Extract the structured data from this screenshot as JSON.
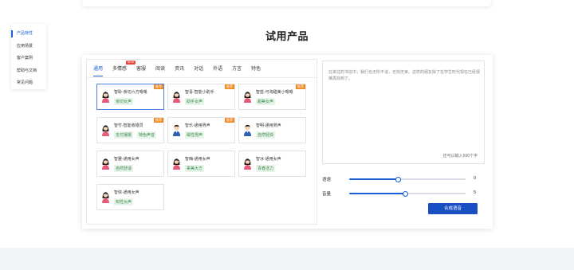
{
  "side_nav": {
    "items": [
      {
        "label": "产品特性",
        "active": true
      },
      {
        "label": "应用场景",
        "active": false
      },
      {
        "label": "客户案例",
        "active": false
      },
      {
        "label": "帮助与文档",
        "active": false
      },
      {
        "label": "常见问题",
        "active": false
      }
    ]
  },
  "section_title": "试用产品",
  "tabs": [
    {
      "label": "通用",
      "active": true,
      "badge": null
    },
    {
      "label": "多情感",
      "active": false,
      "badge": "NEW"
    },
    {
      "label": "客服",
      "active": false,
      "badge": null
    },
    {
      "label": "阅读",
      "active": false,
      "badge": null
    },
    {
      "label": "资讯",
      "active": false,
      "badge": null
    },
    {
      "label": "对话",
      "active": false,
      "badge": null
    },
    {
      "label": "外语",
      "active": false,
      "badge": null
    },
    {
      "label": "方言",
      "active": false,
      "badge": null
    },
    {
      "label": "特色",
      "active": false,
      "badge": null
    }
  ],
  "voices": [
    {
      "name": "智聆-亲切六方嗯嗯",
      "tags": [
        "亲切女声"
      ],
      "badge": "推荐",
      "selected": true,
      "gender": "female"
    },
    {
      "name": "智喜-智能小助手",
      "tags": [
        "助手女声"
      ],
      "badge": "推荐",
      "selected": false,
      "gender": "female"
    },
    {
      "name": "智蓝-可淘甜美小嗯嗯",
      "tags": [
        "甜美女声"
      ],
      "badge": "推荐",
      "selected": false,
      "gender": "female"
    },
    {
      "name": "智竹-智能收银员",
      "tags": [
        "支付播报",
        "特色声音"
      ],
      "badge": "推荐",
      "selected": false,
      "gender": "female"
    },
    {
      "name": "智乐-通用男声",
      "tags": [
        "磁性男声"
      ],
      "badge": "推荐",
      "selected": false,
      "gender": "male"
    },
    {
      "name": "智明-通用男声",
      "tags": [
        "自然轻快"
      ],
      "badge": null,
      "selected": false,
      "gender": "male"
    },
    {
      "name": "智雅-通用女声",
      "tags": [
        "自然舒适"
      ],
      "badge": null,
      "selected": false,
      "gender": "female"
    },
    {
      "name": "智梅-通用女声",
      "tags": [
        "柔美大方"
      ],
      "badge": null,
      "selected": false,
      "gender": "female"
    },
    {
      "name": "智冰-通用女声",
      "tags": [
        "青春活力"
      ],
      "badge": null,
      "selected": false,
      "gender": "female"
    },
    {
      "name": "智依-通用女声",
      "tags": [
        "知性女声"
      ],
      "badge": null,
      "selected": false,
      "gender": "female"
    }
  ],
  "text_input": {
    "value": "在来往的书信中，我们也无所不谈，无拘无束。这样的朋友除了在学生时代现在已经很难再找到了。",
    "char_limit": "还可以输入500个字"
  },
  "sliders": [
    {
      "label": "语速",
      "value": "0",
      "level": 0.42
    },
    {
      "label": "音量",
      "value": "5",
      "level": 0.48
    }
  ],
  "synth_button": "合成语音",
  "colors": {
    "accent": "#1a5fd6",
    "badge_orange": "#f08a24",
    "badge_red": "#e8423a",
    "tag_green": "#3d8a4a",
    "tag_bg": "#e6f4ea"
  }
}
